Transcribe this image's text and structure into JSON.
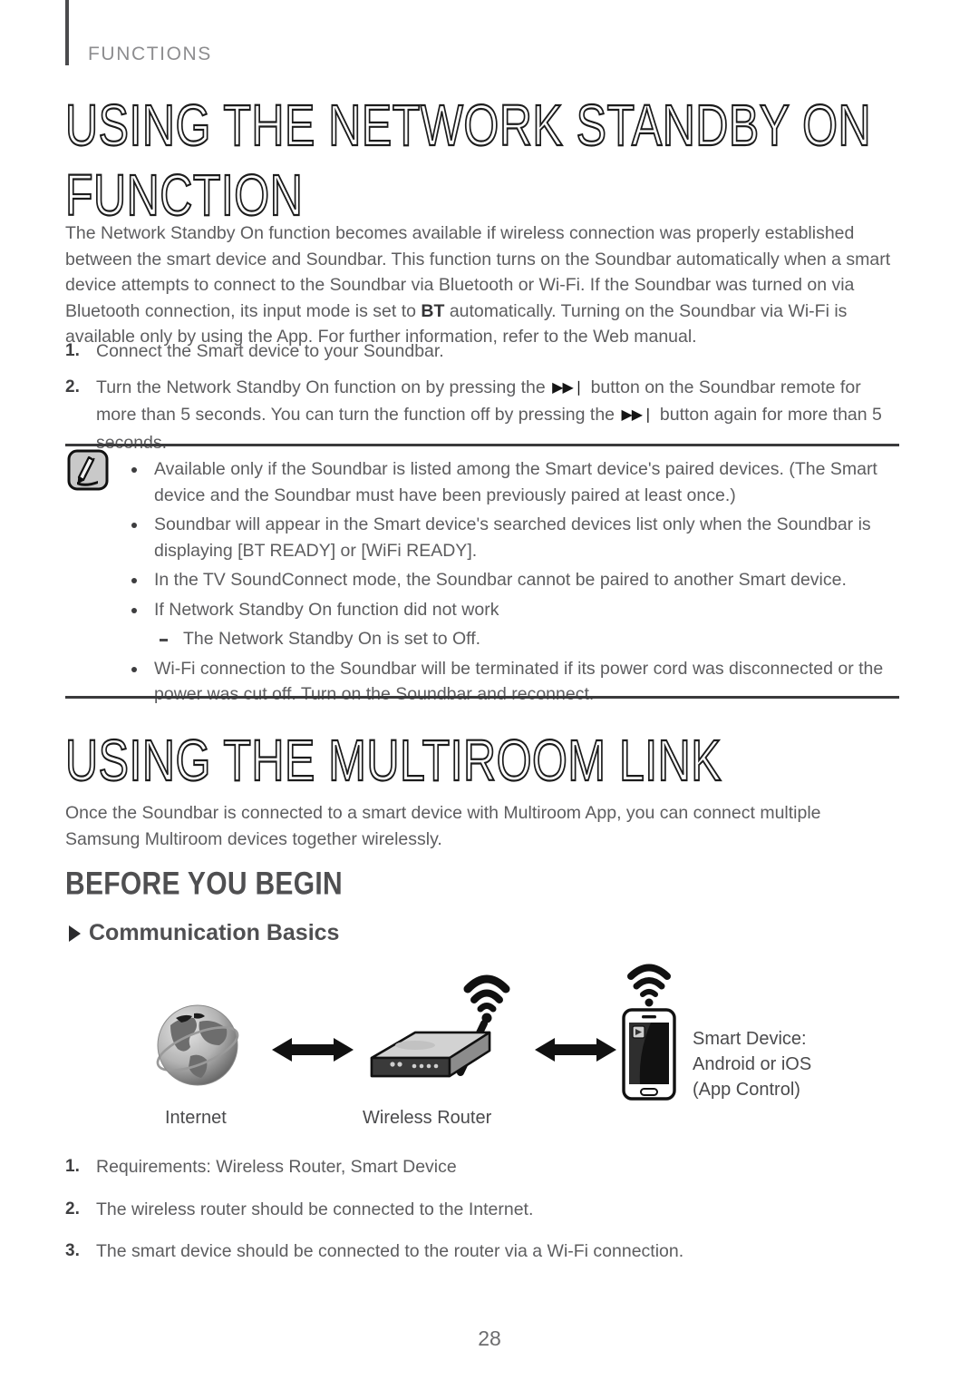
{
  "header": {
    "kicker": "FUNCTIONS"
  },
  "sections": [
    {
      "title": "USING THE NETWORK STANDBY ON FUNCTION"
    },
    {
      "title": "USING THE MULTIROOM LINK"
    }
  ],
  "intro_network": {
    "part1": "The Network Standby On function becomes available if wireless connection was properly established between the smart device and Soundbar. This function turns on the Soundbar automatically when a smart device attempts to connect to the Soundbar via Bluetooth or Wi-Fi. If the Soundbar was turned on via Bluetooth connection, its input mode is set to ",
    "bt": "BT",
    "part2": " automatically. Turning on the Soundbar via Wi-Fi is available only by using the App. For further information, refer to the Web manual."
  },
  "steps": [
    {
      "index": "1.",
      "text": "Connect the Smart device to your Soundbar."
    },
    {
      "index": "2.",
      "part1": "Turn the Network Standby On function on by pressing the ",
      "glyph1": "▶▶❘",
      "part2": " button on the Soundbar remote for more than 5 seconds. You can turn the function off by pressing the ",
      "glyph2": "▶▶❘",
      "part3": " button again for more than 5 seconds."
    }
  ],
  "note": {
    "icon": "note-pencil-icon",
    "bullets": [
      "Available only if the Soundbar is listed among the Smart device's paired devices. (The Smart device and the Soundbar must have been previously paired at least once.)",
      "Soundbar will appear in the Smart device's searched devices list only when the Soundbar is displaying [BT READY] or [WiFi READY].",
      "In the TV SoundConnect mode, the Soundbar cannot be paired to another Smart device.",
      "If Network Standby On function did not work",
      "Wi-Fi connection to the Soundbar will be terminated if its power cord was disconnected or the power was cut off. Turn on the Soundbar and reconnect."
    ],
    "sub_dash": "The Network Standby On is set to Off."
  },
  "intro_multiroom": "Once the Soundbar is connected to a smart device with Multiroom App, you can connect multiple Samsung Multiroom devices together wirelessly.",
  "before_you_begin": {
    "heading": "BEFORE YOU BEGIN",
    "subheading": "Communication Basics"
  },
  "diagram": {
    "internet_label": "Internet",
    "router_label": "Wireless Router",
    "smart_device_lines": [
      "Smart Device:",
      "Android or iOS",
      "(App Control)"
    ],
    "icons": {
      "globe": "globe-icon",
      "arrow": "double-arrow-icon",
      "router": "wireless-router-icon",
      "wifi": "wifi-signal-icon",
      "phone": "smartphone-icon"
    }
  },
  "requirements": [
    {
      "index": "1.",
      "text": "Requirements: Wireless Router, Smart Device"
    },
    {
      "index": "2.",
      "text": "The wireless router should be connected to the Internet."
    },
    {
      "index": "3.",
      "text": "The smart device should be connected to the router via a Wi-Fi connection."
    }
  ],
  "footer": {
    "page_number": "28"
  },
  "colors": {
    "text": "#5d5d5f",
    "rule": "#3a3a3c",
    "heading_stroke": "#1c1c1c"
  }
}
